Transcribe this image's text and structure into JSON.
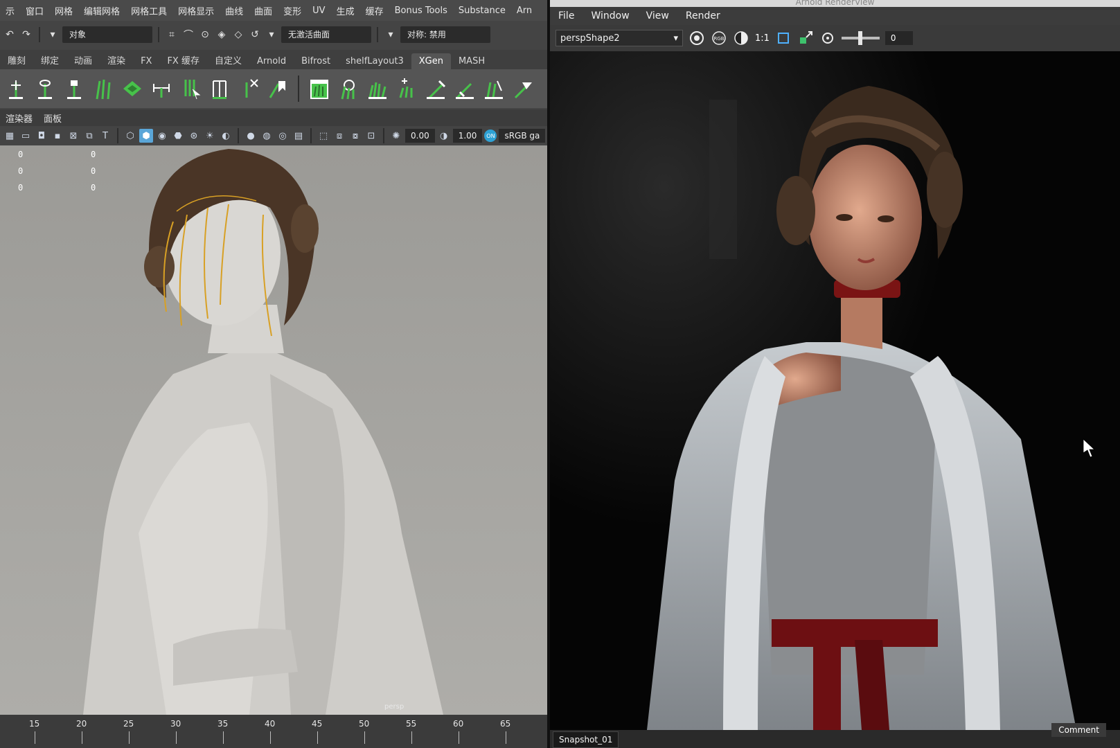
{
  "maya": {
    "menu": [
      "示",
      "窗口",
      "网格",
      "编辑网格",
      "网格工具",
      "网格显示",
      "曲线",
      "曲面",
      "变形",
      "UV",
      "生成",
      "缓存",
      "Bonus Tools",
      "Substance",
      "Arn"
    ],
    "status": {
      "object_label": "对象",
      "live_surface": "无激活曲面",
      "symmetry": "对称: 禁用"
    },
    "shelf_tabs": [
      "雕刻",
      "绑定",
      "动画",
      "渲染",
      "FX",
      "FX 缓存",
      "自定义",
      "Arnold",
      "Bifrost",
      "shelfLayout3",
      "XGen",
      "MASH"
    ],
    "active_shelf_tab": "XGen",
    "panel_menu": [
      "渲染器",
      "面板"
    ],
    "viewport_toolbar": {
      "exposure": "0.00",
      "gamma": "1.00",
      "colorspace": "sRGB ga",
      "toggle_on": "ON"
    },
    "hud": [
      [
        "0",
        "0"
      ],
      [
        "0",
        "0"
      ],
      [
        "0",
        "0"
      ]
    ],
    "camera_label": "persp",
    "timeline_ticks": [
      "15",
      "20",
      "25",
      "30",
      "35",
      "40",
      "45",
      "50",
      "55",
      "60",
      "65"
    ]
  },
  "arnold": {
    "window_title": "Arnold RenderView",
    "menu": [
      "File",
      "Window",
      "View",
      "Render"
    ],
    "camera": "perspShape2",
    "rgb_label": "RGB",
    "ratio_label": "1:1",
    "frame_value": "0",
    "snapshot": "Snapshot_01",
    "comment": "Comment"
  },
  "colors": {
    "xgen_green": "#47c24a",
    "viewport_active_blue": "#5aa6d8",
    "guide_gold": "#d8a024",
    "sash_red": "#7a1414"
  }
}
